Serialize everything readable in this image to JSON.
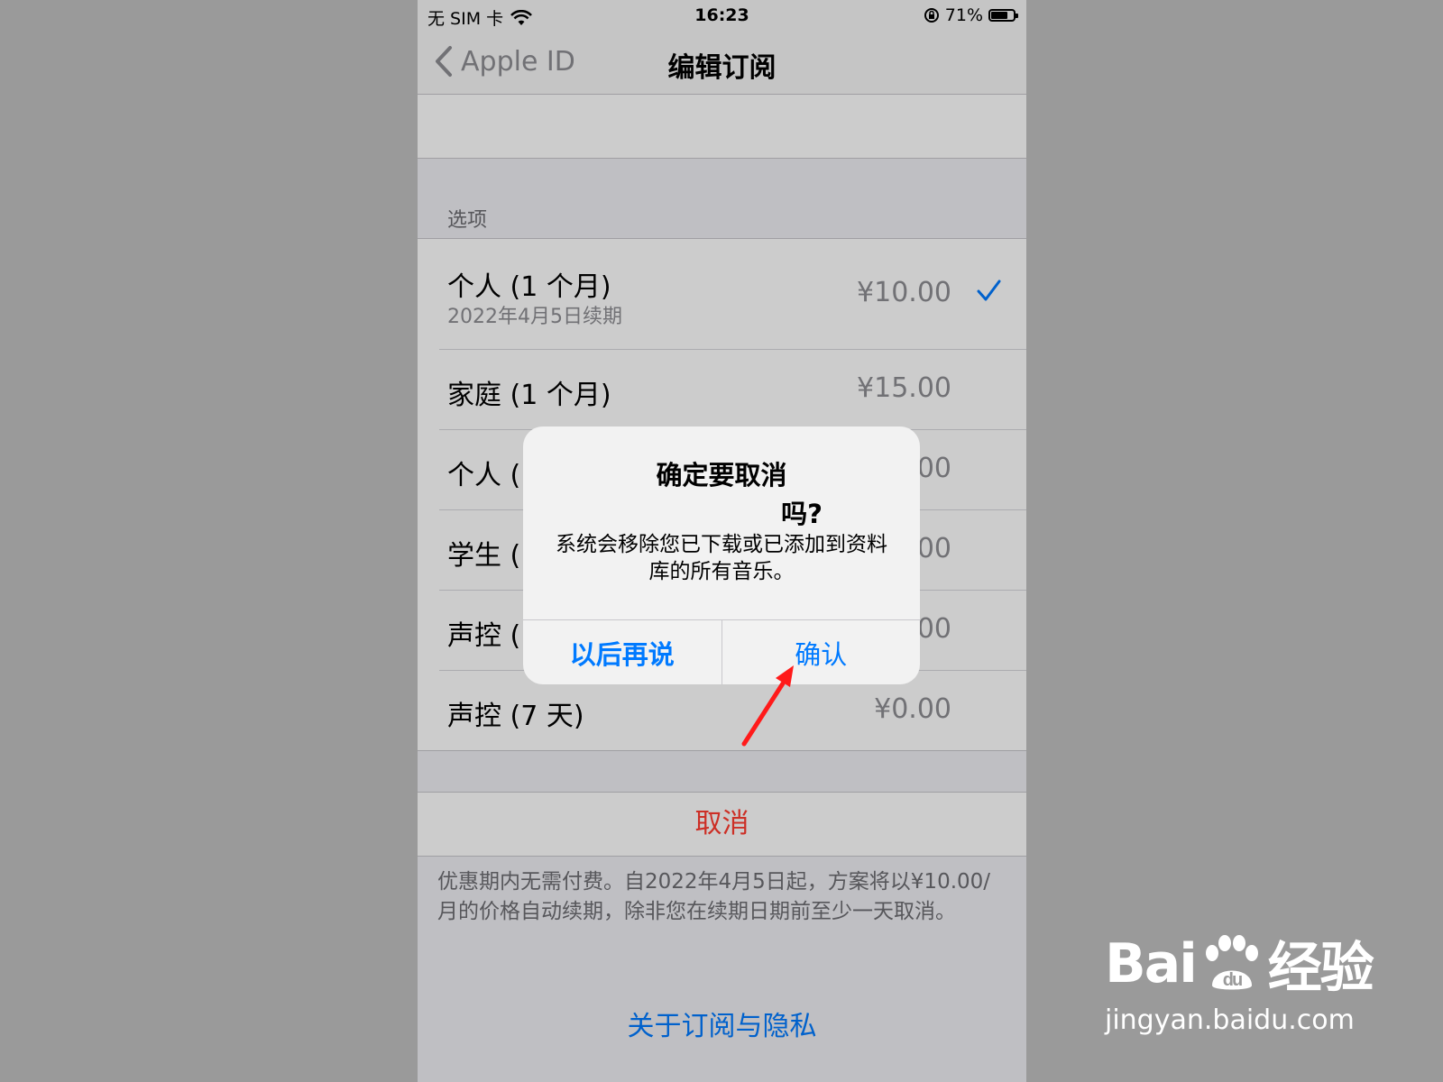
{
  "status_bar": {
    "carrier": "无 SIM 卡",
    "time": "16:23",
    "battery": "71%"
  },
  "nav": {
    "back_label": "Apple ID",
    "title": "编辑订阅"
  },
  "section_header": "选项",
  "options": [
    {
      "title": "个人 (1 个月)",
      "subtitle": "2022年4月5日续期",
      "price": "¥10.00",
      "selected": true
    },
    {
      "title": "家庭 (1 个月)",
      "price": "¥15.00"
    },
    {
      "title": "个人 (",
      "price": "00"
    },
    {
      "title": "学生 (",
      "price": "00"
    },
    {
      "title": "声控 (",
      "price": "00"
    },
    {
      "title": "声控 (7 天)",
      "price": "¥0.00"
    }
  ],
  "cancel_label": "取消",
  "footnote": "优惠期内无需付费。自2022年4月5日起，方案将以¥10.00/月的价格自动续期，除非您在续期日期前至少一天取消。",
  "privacy_link": "关于订阅与隐私",
  "alert": {
    "title": "确定要取消",
    "title_suffix": "吗?",
    "message": "系统会移除您已下载或已添加到资料库的所有音乐。",
    "later_label": "以后再说",
    "confirm_label": "确认"
  },
  "colors": {
    "accent": "#007aff",
    "destructive": "#ff3b30",
    "annotation": "#ff1a1a"
  },
  "watermark": {
    "logo_text_left": "Bai",
    "logo_text_right": "经验",
    "url": "jingyan.baidu.com"
  }
}
